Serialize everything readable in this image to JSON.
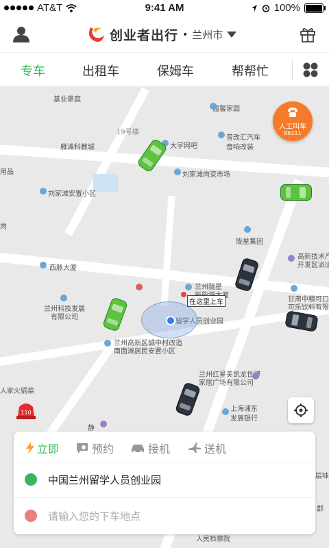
{
  "status": {
    "carrier": "AT&T",
    "time": "9:41 AM",
    "battery": "100%"
  },
  "header": {
    "brand": "创业者出行",
    "dot": "•",
    "city": "兰州市"
  },
  "tabs": [
    {
      "label": "专车"
    },
    {
      "label": "出租车"
    },
    {
      "label": "保姆车"
    },
    {
      "label": "帮帮忙"
    }
  ],
  "map": {
    "labels": {
      "a": "基业豪庭",
      "b": "温馨家园",
      "c": "雁滩科教城",
      "d": "大宇网吧",
      "e": "音改汇汽车",
      "f": "音响改装",
      "g": "刘家滩肉菜市场",
      "h": "刘家滩安置小区",
      "i": "陇星集团",
      "j": "高新技术产",
      "k": "开发区派出",
      "l": "西脉大厦",
      "m": "兰州陇星",
      "n": "新能源大厦",
      "o": "留学人员创业园",
      "p": "兰州科技发展",
      "q": "有限公司",
      "r": "甘肃中粮可口",
      "s": "可乐饮料有限",
      "t": "兰州高新区城中村改造",
      "u": "南面滩居民安置小区",
      "v": "兰州红星美凯龙世博",
      "w": "家居广场有限公司",
      "x": "上海浦东",
      "y": "发展银行",
      "z": "人家火锅菜",
      "aa": "19号楼",
      "ab": "用品",
      "ac": "肉",
      "ad": "层味",
      "ae": "郡",
      "af": "人民检察院",
      "ag": "静"
    },
    "pickup_label": "在这里上车"
  },
  "call_button": {
    "line1": "人工叫车",
    "line2": "96111"
  },
  "sos": {
    "label": "110"
  },
  "panel": {
    "modes": [
      {
        "label": "立即"
      },
      {
        "label": "预约"
      },
      {
        "label": "接机"
      },
      {
        "label": "送机"
      }
    ],
    "from": "中国兰州留学人员创业园",
    "to_placeholder": "请输入您的下车地点"
  }
}
